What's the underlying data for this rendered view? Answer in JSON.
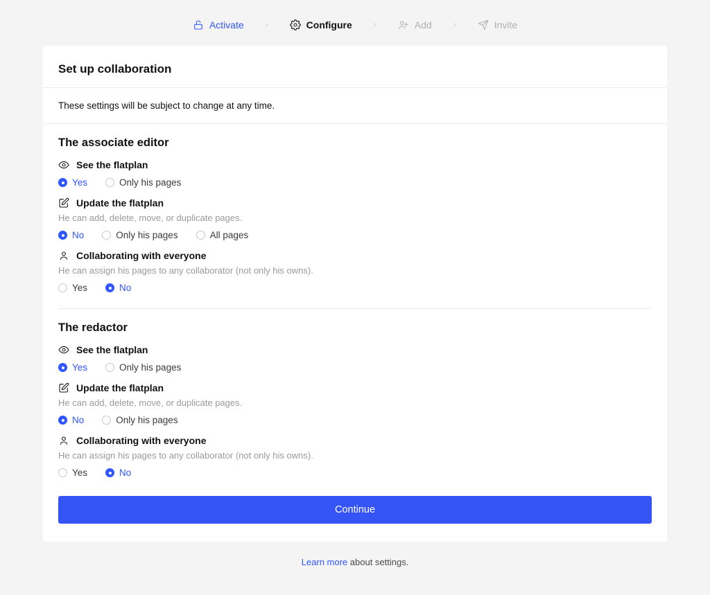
{
  "stepper": {
    "items": [
      {
        "label": "Activate",
        "state": "done",
        "icon": "unlock-icon"
      },
      {
        "label": "Configure",
        "state": "active",
        "icon": "gear-icon"
      },
      {
        "label": "Add",
        "state": "pending",
        "icon": "user-plus-icon"
      },
      {
        "label": "Invite",
        "state": "pending",
        "icon": "send-icon"
      }
    ]
  },
  "page": {
    "title": "Set up collaboration",
    "subtitle": "These settings will be subject to change at any time."
  },
  "roles": [
    {
      "name": "The associate editor",
      "settings": [
        {
          "icon": "eye-icon",
          "label": "See the flatplan",
          "desc": "",
          "options": [
            "Yes",
            "Only his pages"
          ],
          "selected": "Yes"
        },
        {
          "icon": "edit-icon",
          "label": "Update the flatplan",
          "desc": "He can add, delete, move, or duplicate pages.",
          "options": [
            "No",
            "Only his pages",
            "All pages"
          ],
          "selected": "No"
        },
        {
          "icon": "user-icon",
          "label": "Collaborating with everyone",
          "desc": "He can assign his pages to any collaborator (not only his owns).",
          "options": [
            "Yes",
            "No"
          ],
          "selected": "No"
        }
      ]
    },
    {
      "name": "The redactor",
      "settings": [
        {
          "icon": "eye-icon",
          "label": "See the flatplan",
          "desc": "",
          "options": [
            "Yes",
            "Only his pages"
          ],
          "selected": "Yes"
        },
        {
          "icon": "edit-icon",
          "label": "Update the flatplan",
          "desc": "He can add, delete, move, or duplicate pages.",
          "options": [
            "No",
            "Only his pages"
          ],
          "selected": "No"
        },
        {
          "icon": "user-icon",
          "label": "Collaborating with everyone",
          "desc": "He can assign his pages to any collaborator (not only his owns).",
          "options": [
            "Yes",
            "No"
          ],
          "selected": "No"
        }
      ]
    }
  ],
  "continue_label": "Continue",
  "footer": {
    "link": "Learn more",
    "tail": " about settings."
  }
}
